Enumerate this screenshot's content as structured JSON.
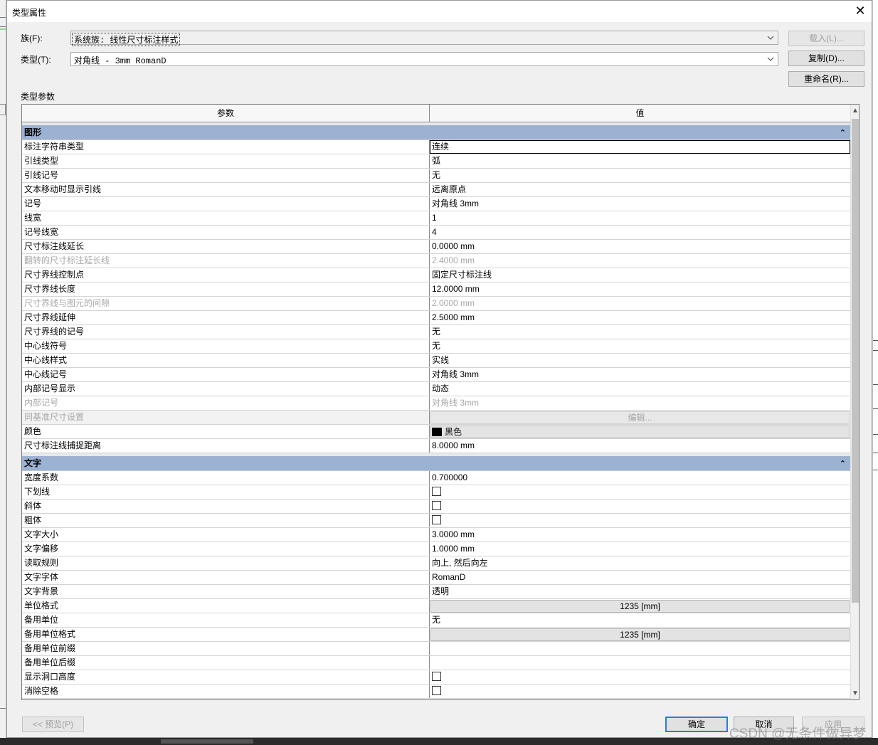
{
  "dialog": {
    "title": "类型属性",
    "family_label": "族(F):",
    "family_value": "系统族: 线性尺寸标注样式",
    "type_label": "类型(T):",
    "type_value": "对角线 - 3mm RomanD",
    "load_button": "载入(L)...",
    "duplicate_button": "复制(D)...",
    "rename_button": "重命名(R)...",
    "type_params_caption": "类型参数"
  },
  "table": {
    "col_param": "参数",
    "col_value": "值"
  },
  "groups": {
    "graphics": {
      "label": "图形",
      "rows": [
        {
          "param": "标注字符串类型",
          "value": "连续",
          "kind": "text",
          "selected": true
        },
        {
          "param": "引线类型",
          "value": "弧",
          "kind": "text"
        },
        {
          "param": "引线记号",
          "value": "无",
          "kind": "text"
        },
        {
          "param": "文本移动时显示引线",
          "value": "远离原点",
          "kind": "text"
        },
        {
          "param": "记号",
          "value": "对角线 3mm",
          "kind": "text"
        },
        {
          "param": "线宽",
          "value": "1",
          "kind": "text"
        },
        {
          "param": "记号线宽",
          "value": "4",
          "kind": "text"
        },
        {
          "param": "尺寸标注线延长",
          "value": "0.0000 mm",
          "kind": "text"
        },
        {
          "param": "翻转的尺寸标注延长线",
          "value": "2.4000 mm",
          "kind": "text",
          "disabled": true
        },
        {
          "param": "尺寸界线控制点",
          "value": "固定尺寸标注线",
          "kind": "text"
        },
        {
          "param": "尺寸界线长度",
          "value": "12.0000 mm",
          "kind": "text"
        },
        {
          "param": "尺寸界线与图元的间隙",
          "value": "2.0000 mm",
          "kind": "text",
          "disabled": true
        },
        {
          "param": "尺寸界线延伸",
          "value": "2.5000 mm",
          "kind": "text"
        },
        {
          "param": "尺寸界线的记号",
          "value": "无",
          "kind": "text"
        },
        {
          "param": "中心线符号",
          "value": "无",
          "kind": "text"
        },
        {
          "param": "中心线样式",
          "value": "实线",
          "kind": "text"
        },
        {
          "param": "中心线记号",
          "value": "对角线 3mm",
          "kind": "text"
        },
        {
          "param": "内部记号显示",
          "value": "动态",
          "kind": "text"
        },
        {
          "param": "内部记号",
          "value": "对角线 3mm",
          "kind": "text",
          "disabled": true
        },
        {
          "param": "同基准尺寸设置",
          "value": "编辑...",
          "kind": "button",
          "disabled": true
        },
        {
          "param": "颜色",
          "value": "黑色",
          "kind": "color",
          "swatch": "#000000"
        },
        {
          "param": "尺寸标注线捕捉距离",
          "value": "8.0000 mm",
          "kind": "text"
        }
      ]
    },
    "text": {
      "label": "文字",
      "rows": [
        {
          "param": "宽度系数",
          "value": "0.700000",
          "kind": "text"
        },
        {
          "param": "下划线",
          "value": "",
          "kind": "checkbox",
          "checked": false
        },
        {
          "param": "斜体",
          "value": "",
          "kind": "checkbox",
          "checked": false
        },
        {
          "param": "粗体",
          "value": "",
          "kind": "checkbox",
          "checked": false
        },
        {
          "param": "文字大小",
          "value": "3.0000 mm",
          "kind": "text"
        },
        {
          "param": "文字偏移",
          "value": "1.0000 mm",
          "kind": "text"
        },
        {
          "param": "读取规则",
          "value": "向上, 然后向左",
          "kind": "text"
        },
        {
          "param": "文字字体",
          "value": "RomanD",
          "kind": "text"
        },
        {
          "param": "文字背景",
          "value": "透明",
          "kind": "text"
        },
        {
          "param": "单位格式",
          "value": "1235 [mm]",
          "kind": "button"
        },
        {
          "param": "备用单位",
          "value": "无",
          "kind": "text"
        },
        {
          "param": "备用单位格式",
          "value": "1235 [mm]",
          "kind": "button"
        },
        {
          "param": "备用单位前缀",
          "value": "",
          "kind": "text"
        },
        {
          "param": "备用单位后缀",
          "value": "",
          "kind": "text"
        },
        {
          "param": "显示洞口高度",
          "value": "",
          "kind": "checkbox",
          "checked": false
        },
        {
          "param": "消除空格",
          "value": "",
          "kind": "checkbox",
          "checked": false
        }
      ]
    }
  },
  "footer": {
    "preview_button": "<< 预览(P)",
    "ok_button": "确定",
    "cancel_button": "取消",
    "apply_button": "应用"
  },
  "watermark": "CSDN @无条件做异梦"
}
